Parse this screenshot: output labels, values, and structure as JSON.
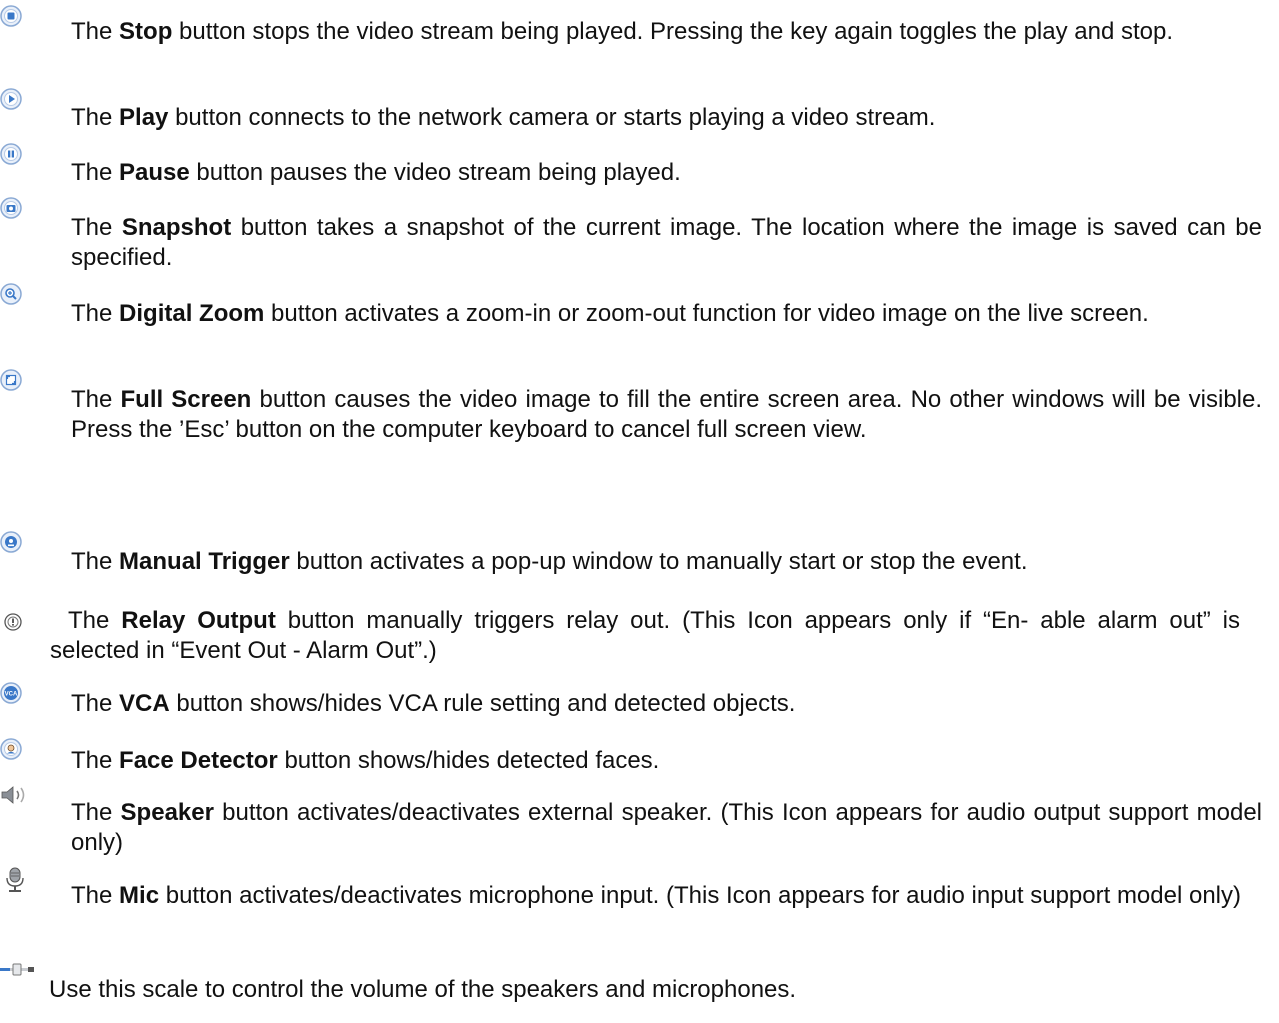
{
  "entries": [
    {
      "icon": "stop-icon",
      "pre": "The",
      "name": "Stop",
      "desc": "button stops the video stream being played. Pressing the key again toggles the play and stop."
    },
    {
      "icon": "play-icon",
      "pre": "The",
      "name": "Play",
      "desc": "button connects to the network camera or starts playing a video stream."
    },
    {
      "icon": "pause-icon",
      "pre": "The",
      "name": "Pause",
      "desc": "button pauses the video stream being played."
    },
    {
      "icon": "snapshot-icon",
      "pre": "The",
      "name": "Snapshot",
      "desc": "button takes a snapshot of the current image. The location where the image is saved can be specified."
    },
    {
      "icon": "digital-zoom-icon",
      "pre": "The",
      "name": "Digital Zoom",
      "desc": "button activates a zoom-in or zoom-out function for video image on the live screen."
    },
    {
      "icon": "full-screen-icon",
      "pre": "The",
      "name": "Full Screen",
      "desc": "button causes the video image to fill the entire screen area. No other windows will be visible. Press the ’Esc’ button on the computer keyboard to cancel full screen view."
    },
    {
      "icon": "manual-trigger-icon",
      "pre": "The",
      "name": "Manual Trigger",
      "desc": "button activates a pop-up window to manually start or stop the event."
    },
    {
      "icon": "relay-output-icon",
      "pre": "The",
      "name": "Relay Output",
      "desc": "button manually triggers relay out.  (This Icon appears only if “En- able alarm out” is selected in “Event Out - Alarm Out”.)"
    },
    {
      "icon": "vca-icon",
      "pre": "The",
      "name": "VCA",
      "desc": "button shows/hides VCA rule setting and detected objects."
    },
    {
      "icon": "face-detector-icon",
      "pre": "The",
      "name": "Face Detector",
      "desc": "button shows/hides detected faces."
    },
    {
      "icon": "speaker-icon",
      "pre": "The",
      "name": "Speaker",
      "desc": "button activates/deactivates external speaker. (This Icon appears for audio output support model only)"
    },
    {
      "icon": "mic-icon",
      "pre": "The",
      "name": "Mic",
      "desc": "button activates/deactivates microphone input. (This Icon appears for audio input support model only)"
    }
  ],
  "volume": {
    "icon": "volume-scale-icon",
    "text": "Use this scale to control the volume of the speakers and microphones."
  },
  "vca_icon_label": "VCA",
  "colors": {
    "icon_blue": "#3a78c8",
    "icon_ring": "#9ab8de",
    "text": "#111111"
  }
}
